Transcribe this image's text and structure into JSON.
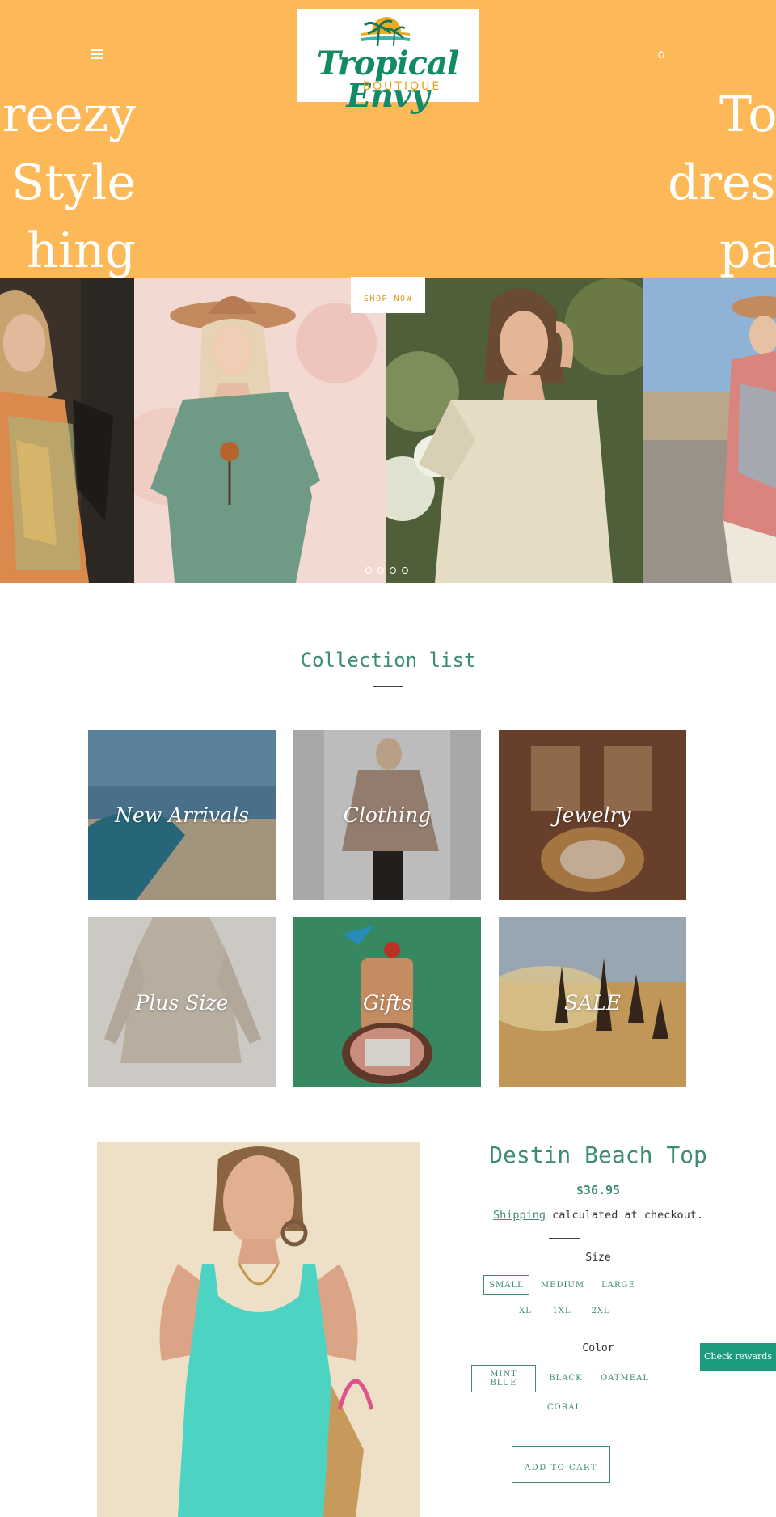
{
  "header": {
    "logo_script": "Tropical Envy",
    "logo_sub": "BOUTIQUE",
    "hero_left_lines": [
      "Breezy",
      "rt Style",
      "hing"
    ],
    "hero_right_lines": [
      "To",
      "dress",
      "par"
    ],
    "shop_now": "SHOP NOW",
    "cart_count": "0"
  },
  "colors": {
    "header_bg": "#fdb957",
    "accent_green": "#3d8c73",
    "shop_gold": "#d9961c",
    "rewards_bg": "#1c9b7f"
  },
  "icons": {
    "menu": "hamburger-icon",
    "cart": "cart-icon"
  },
  "collection": {
    "title": "Collection list",
    "tiles": [
      {
        "label": "New Arrivals"
      },
      {
        "label": "Clothing"
      },
      {
        "label": "Jewelry"
      },
      {
        "label": "Plus Size"
      },
      {
        "label": "Gifts"
      },
      {
        "label": "SALE"
      }
    ]
  },
  "product": {
    "title": "Destin Beach Top",
    "price": "$36.95",
    "shipping_link": "Shipping",
    "shipping_text": " calculated at checkout.",
    "size_label": "Size",
    "sizes": [
      "SMALL",
      "MEDIUM",
      "LARGE",
      "XL",
      "1XL",
      "2XL"
    ],
    "size_selected": "SMALL",
    "color_label": "Color",
    "colors": [
      "MINT BLUE",
      "BLACK",
      "OATMEAL",
      "CORAL"
    ],
    "color_selected": "MINT BLUE",
    "add_to_cart": "ADD TO CART"
  },
  "rewards": {
    "label": "Check rewards"
  }
}
